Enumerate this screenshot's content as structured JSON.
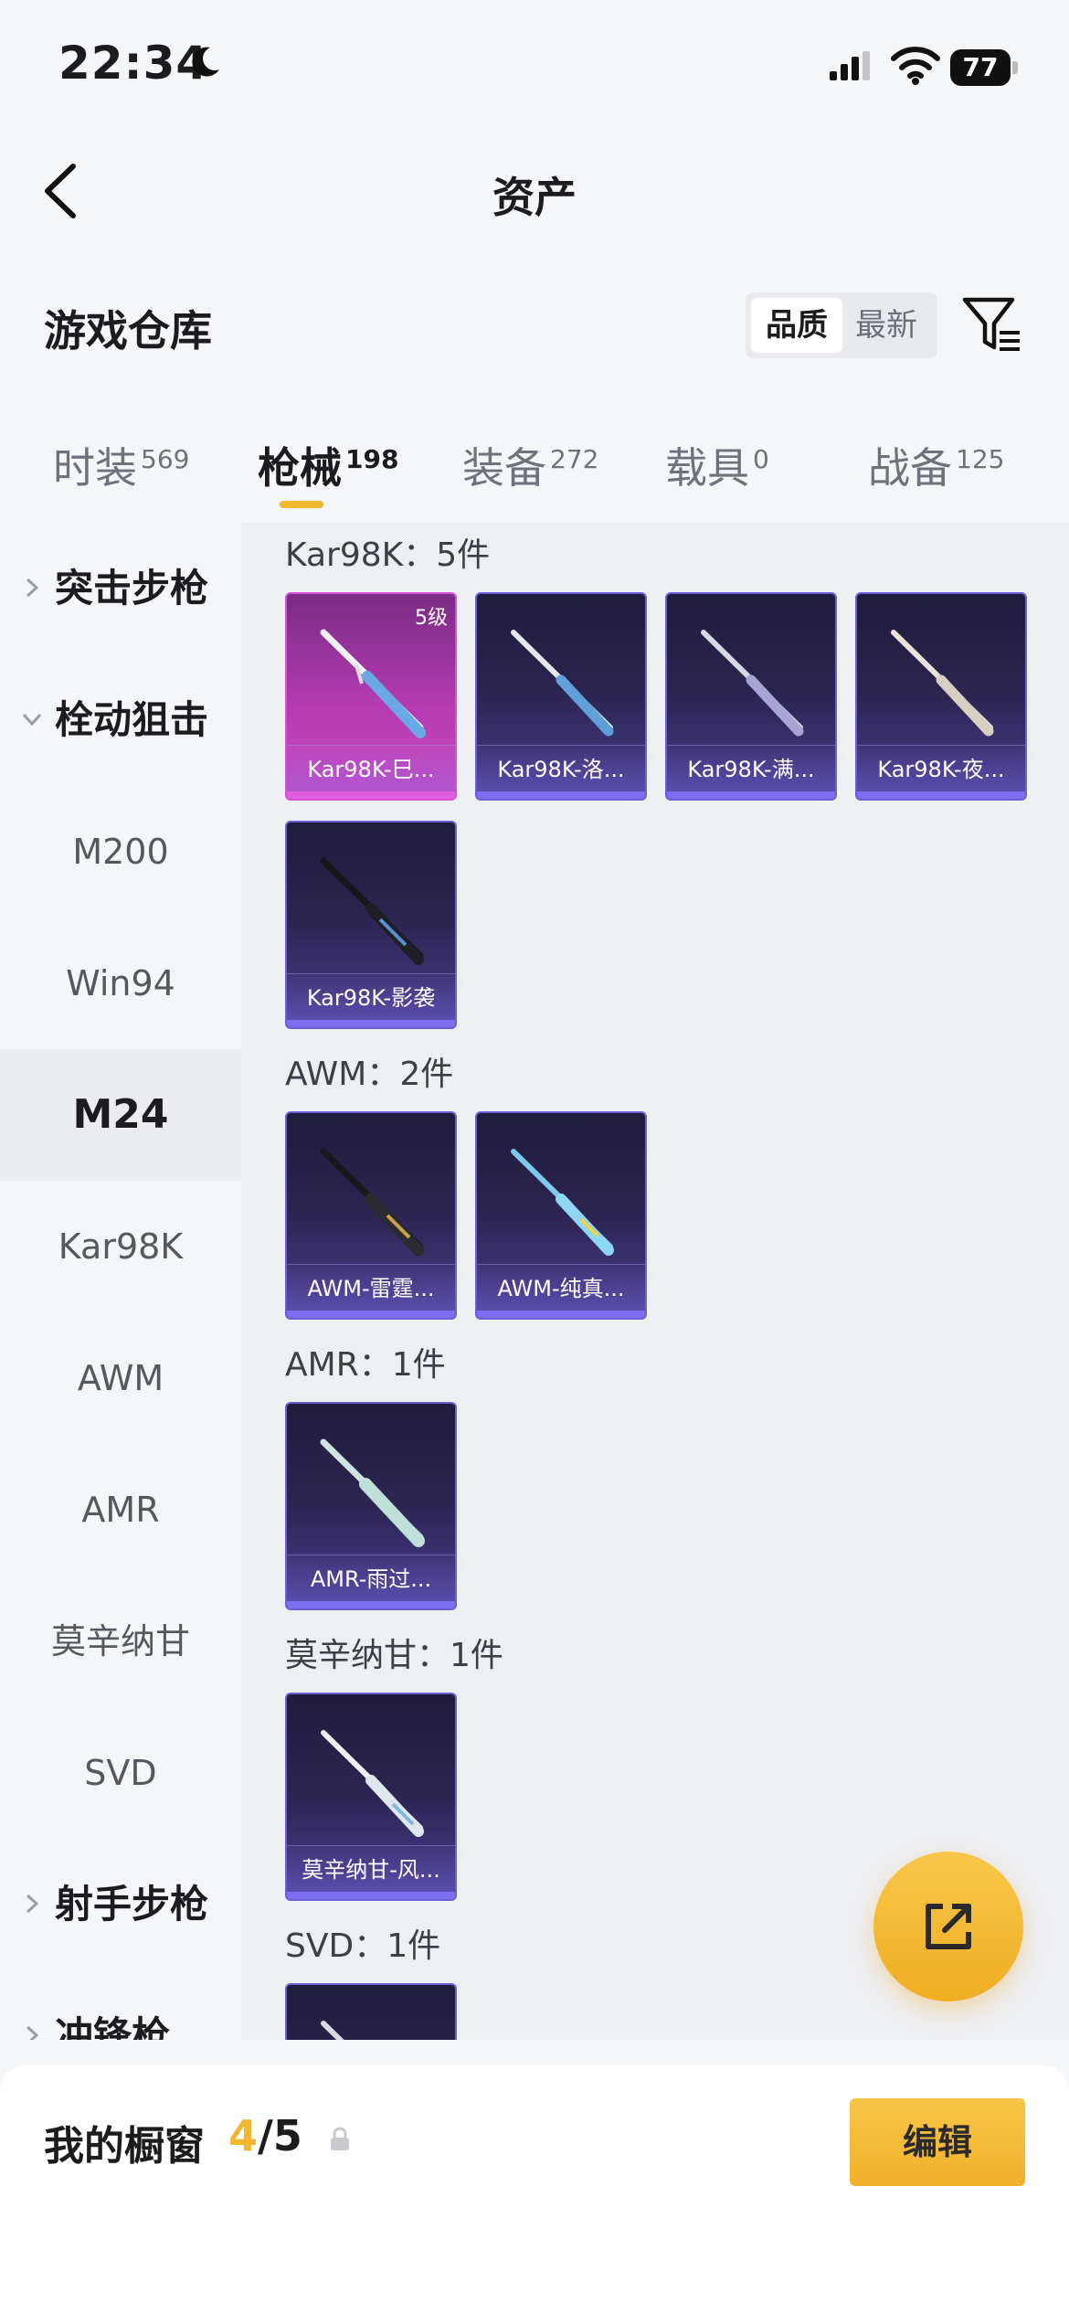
{
  "status_bar": {
    "time": "22:34",
    "battery": "77"
  },
  "nav": {
    "title": "资产"
  },
  "section": {
    "title": "游戏仓库",
    "sort_options": [
      "品质",
      "最新"
    ]
  },
  "tabs": [
    {
      "label": "时装",
      "count": "569"
    },
    {
      "label": "枪械",
      "count": "198"
    },
    {
      "label": "装备",
      "count": "272"
    },
    {
      "label": "载具",
      "count": "0"
    },
    {
      "label": "战备",
      "count": "125"
    }
  ],
  "sidebar": {
    "items": [
      {
        "label": "突击步枪"
      },
      {
        "label": "栓动狙击"
      },
      {
        "label": "M200"
      },
      {
        "label": "Win94"
      },
      {
        "label": "M24"
      },
      {
        "label": "Kar98K"
      },
      {
        "label": "AWM"
      },
      {
        "label": "AMR"
      },
      {
        "label": "莫辛纳甘"
      },
      {
        "label": "SVD"
      },
      {
        "label": "射手步枪"
      },
      {
        "label": "冲锋枪"
      }
    ]
  },
  "groups": [
    {
      "label": "Kar98K：5件",
      "cards": [
        {
          "name": "Kar98K-巳...",
          "level": "5级"
        },
        {
          "name": "Kar98K-洛..."
        },
        {
          "name": "Kar98K-满..."
        },
        {
          "name": "Kar98K-夜..."
        },
        {
          "name": "Kar98K-影袭"
        }
      ]
    },
    {
      "label": "AWM：2件",
      "cards": [
        {
          "name": "AWM-雷霆..."
        },
        {
          "name": "AWM-纯真..."
        }
      ]
    },
    {
      "label": "AMR：1件",
      "cards": [
        {
          "name": "AMR-雨过..."
        }
      ]
    },
    {
      "label": "莫辛纳甘：1件",
      "cards": [
        {
          "name": "莫辛纳甘-风..."
        }
      ]
    },
    {
      "label": "SVD：1件",
      "cards": []
    }
  ],
  "showcase": {
    "title": "我的橱窗",
    "current": "4",
    "total": "/5",
    "edit_label": "编辑"
  }
}
